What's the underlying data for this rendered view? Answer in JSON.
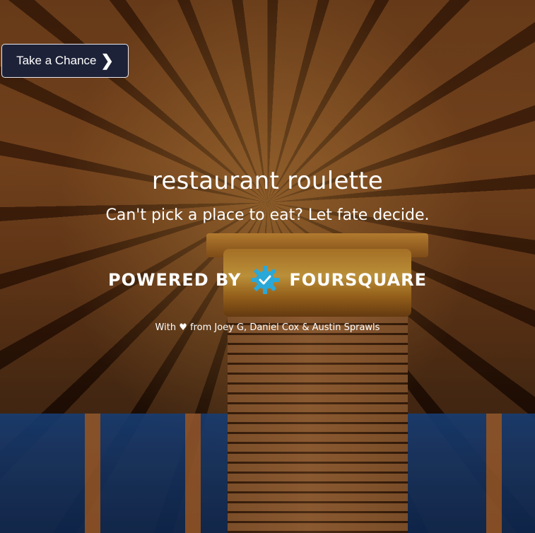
{
  "nav": {
    "chance_label": "Take a Chance",
    "chance_icon": "chevron-right-icon"
  },
  "hero": {
    "title": "restaurant roulette",
    "tagline": "Can't pick a place to eat? Let fate decide."
  },
  "powered": {
    "prefix": "POWERED BY",
    "brand": "FOURSQUARE",
    "logo_icon": "foursquare-gear-icon",
    "logo_color": "#2aa8d8"
  },
  "credits": {
    "text": "With ♥ from Joey G, Daniel Cox & Austin Sprawls"
  }
}
